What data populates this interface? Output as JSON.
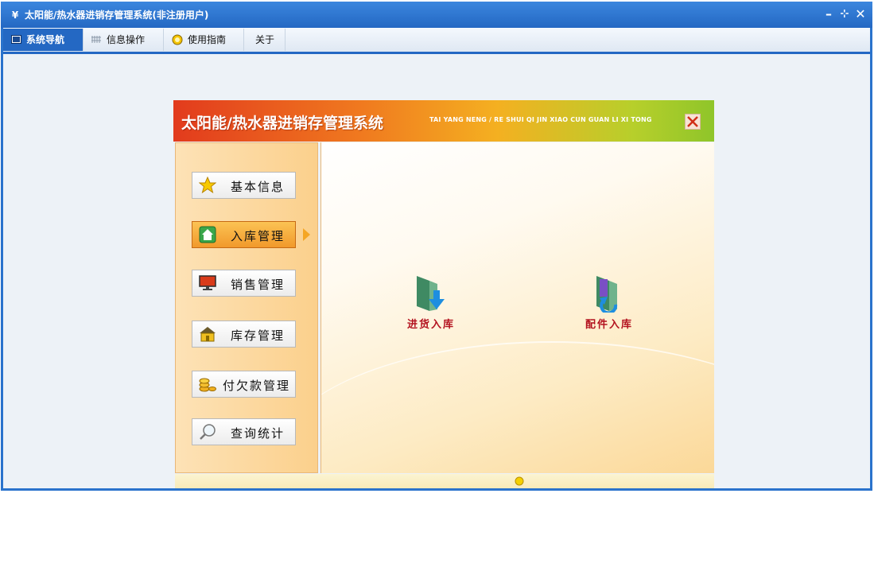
{
  "window": {
    "title": "太阳能/热水器进销存管理系统(非注册用户)",
    "icon": "app-logo-icon",
    "controls": [
      "minimize-icon",
      "restore-icon",
      "close-icon"
    ]
  },
  "menubar": {
    "tabs": [
      {
        "label": "系统导航",
        "icon": "monitor-icon",
        "active": true
      },
      {
        "label": "信息操作",
        "icon": "grid-icon",
        "active": false
      },
      {
        "label": "使用指南",
        "icon": "help-icon",
        "active": false
      },
      {
        "label": "关于",
        "icon": "",
        "active": false
      }
    ]
  },
  "panel": {
    "title": "太阳能/热水器进销存管理系统",
    "subtitle": "TAI YANG NENG / RE SHUI QI JIN XIAO CUN GUAN LI XI TONG",
    "nav": [
      {
        "label": "基本信息",
        "icon": "star-icon",
        "active": false
      },
      {
        "label": "入库管理",
        "icon": "house-icon",
        "active": true
      },
      {
        "label": "销售管理",
        "icon": "monitor-icon",
        "active": false
      },
      {
        "label": "库存管理",
        "icon": "warehouse-icon",
        "active": false
      },
      {
        "label": "付欠款管理",
        "icon": "coins-icon",
        "active": false
      },
      {
        "label": "查询统计",
        "icon": "magnifier-icon",
        "active": false
      }
    ],
    "actions": [
      {
        "label": "进货入库",
        "icon": "folder-arrow-down-icon"
      },
      {
        "label": "配件入库",
        "icon": "folder-parts-icon"
      }
    ]
  },
  "colors": {
    "titlebar": "#2468c3",
    "header_start": "#e23b1d",
    "header_end": "#8fc52a",
    "action_label": "#b3121f",
    "active_button": "#f1992b"
  }
}
